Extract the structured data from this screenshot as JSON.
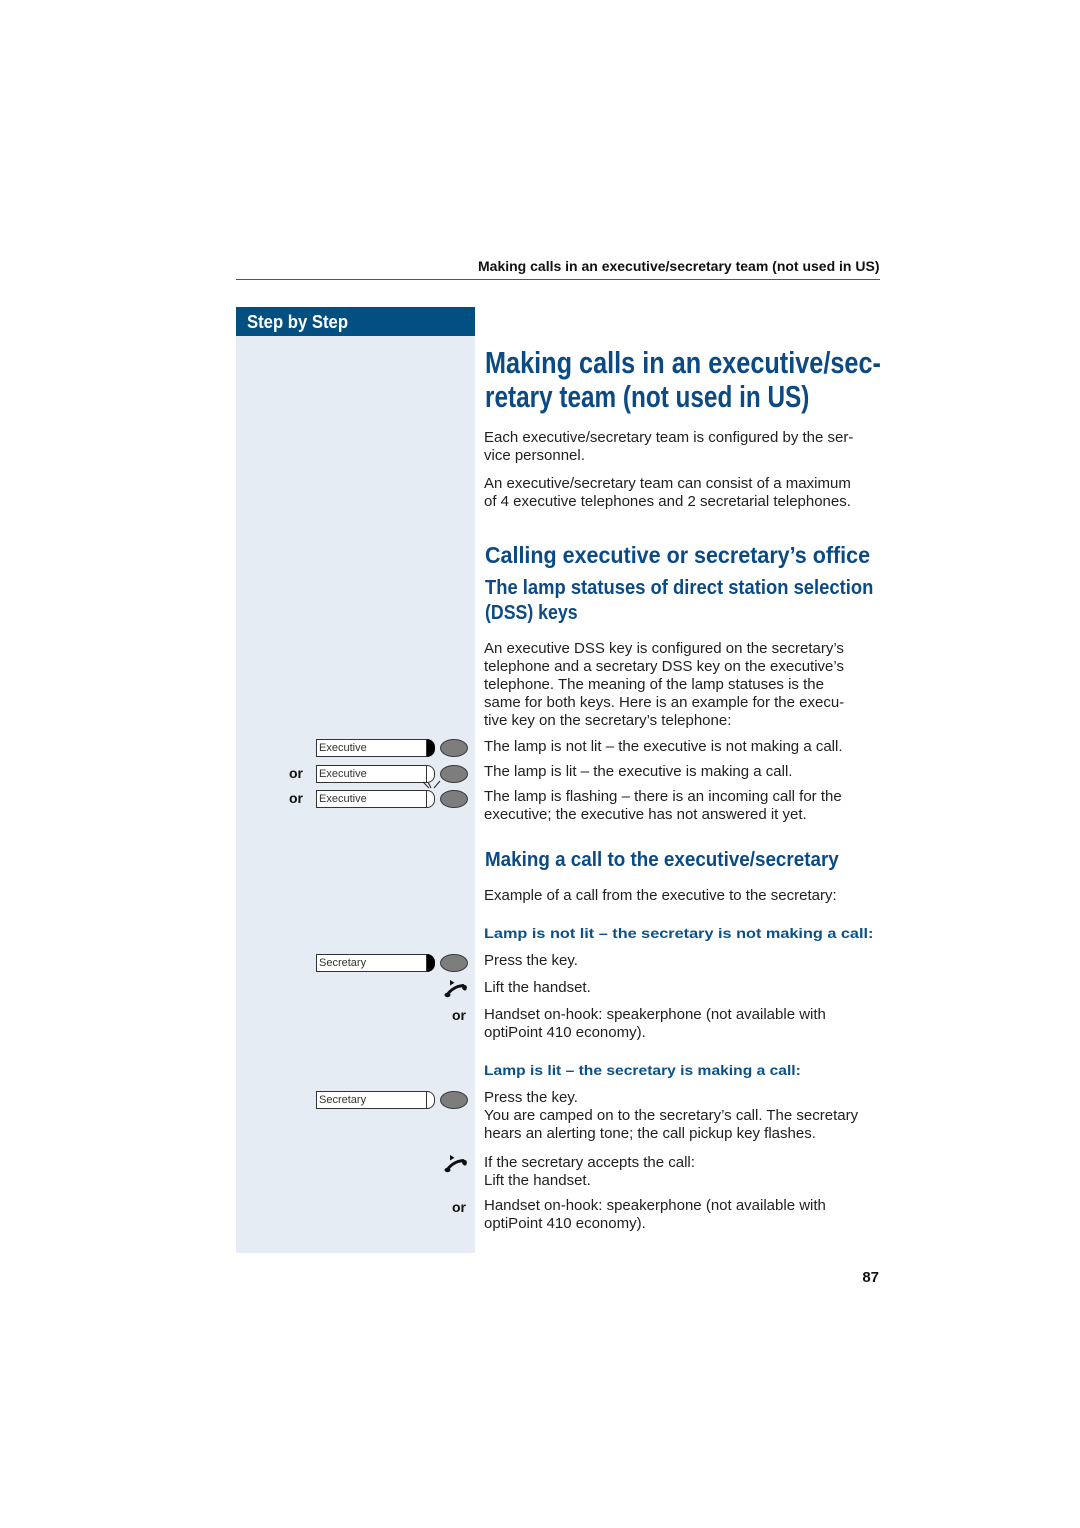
{
  "running_header": "Making calls in an executive/secretary team (not used in US)",
  "sidebar": {
    "title": "Step by Step",
    "lamp_examples": [
      {
        "prefix": "",
        "key_label": "Executive",
        "lamp": "filled"
      },
      {
        "prefix": "or",
        "key_label": "Executive",
        "lamp": "outline"
      },
      {
        "prefix": "or",
        "key_label": "Executive",
        "lamp": "outline-flashing"
      }
    ],
    "case1": {
      "key_label": "Secretary",
      "lamp": "filled",
      "handset_icon": "lift-handset-icon",
      "alt_label": "or"
    },
    "case2": {
      "key_label": "Secretary",
      "lamp": "outline",
      "handset_icon": "lift-handset-icon",
      "alt_label": "or"
    }
  },
  "content": {
    "h1": [
      "Making calls in an executive/sec-",
      "retary team (not used in US)"
    ],
    "intro": [
      [
        "Each executive/secretary team is configured by the ser-",
        "vice personnel."
      ],
      [
        "An executive/secretary team can consist of a maximum",
        "of 4 executive telephones and 2 secretarial telephones."
      ]
    ],
    "h2": "Calling executive or secretary’s office",
    "h3_lamp": [
      "The lamp statuses of direct station selection",
      "(DSS) keys"
    ],
    "dss_para": [
      "An executive DSS key is configured on the secretary’s",
      "telephone and a secretary DSS key on the executive’s",
      "telephone. The meaning of the lamp statuses is the",
      "same for both keys. Here is an example for the execu-",
      "tive key on the secretary’s telephone:"
    ],
    "lamp_states": [
      [
        "The lamp is not lit – the executive is not making a call."
      ],
      [
        "The lamp is lit – the executive is making a call."
      ],
      [
        "The lamp is flashing – there is an incoming call for the",
        "executive; the executive has not answered it yet."
      ]
    ],
    "h3_call": "Making a call to the executive/secretary",
    "example": "Example of a call from the executive to the secretary:",
    "case1": {
      "title": "Lamp is not lit – the secretary is not making a call:",
      "press": "Press the key.",
      "lift": "Lift the handset.",
      "alt": [
        "Handset on-hook: speakerphone (not available with",
        "optiPoint 410 economy)."
      ]
    },
    "case2": {
      "title": "Lamp is lit – the secretary is making a call:",
      "press": [
        "Press the key.",
        "You are camped on to the secretary’s call. The secretary",
        "hears an alerting tone; the call pickup key flashes."
      ],
      "accept": [
        "If the secretary accepts the call:",
        "Lift the handset."
      ],
      "alt": [
        "Handset on-hook: speakerphone (not available with",
        "optiPoint 410 economy)."
      ]
    }
  },
  "page_number": "87",
  "colors": {
    "heading_blue": "#0b4a83",
    "sidebar_header": "#024f82",
    "sidebar_bg": "#e6ecf3"
  }
}
